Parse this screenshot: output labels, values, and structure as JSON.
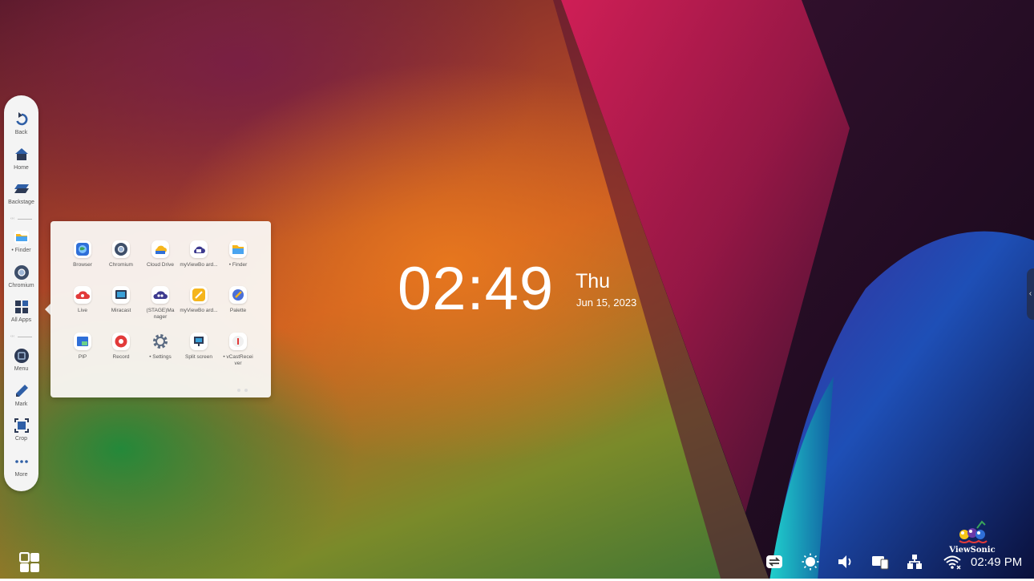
{
  "colors": {
    "toolbar_bg": "#f4f4f4",
    "accent_blue": "#2f5fa6",
    "icon_dark": "#2d3a55"
  },
  "toolbar": {
    "items": [
      {
        "label": "Back",
        "icon": "back-arrow-icon"
      },
      {
        "label": "Home",
        "icon": "home-icon"
      },
      {
        "label": "Backstage",
        "icon": "backstage-icon"
      },
      {
        "label": "• Finder",
        "icon": "folder-icon"
      },
      {
        "label": "Chromium",
        "icon": "chromium-icon"
      },
      {
        "label": "All Apps",
        "icon": "grid-icon"
      },
      {
        "label": "Menu",
        "icon": "menu-icon"
      },
      {
        "label": "Mark",
        "icon": "pen-icon"
      },
      {
        "label": "Crop",
        "icon": "crop-icon"
      },
      {
        "label": "More",
        "icon": "more-dots-icon"
      }
    ],
    "separator_text": "‹‹‹"
  },
  "apps_popup": {
    "apps": [
      {
        "label": "Browser",
        "icon": "browser-icon"
      },
      {
        "label": "Chromium",
        "icon": "chromium-icon"
      },
      {
        "label": "Cloud Drive",
        "icon": "cloud-drive-icon"
      },
      {
        "label": "myViewBo ard...",
        "icon": "myviewboard-icon"
      },
      {
        "label": "• Finder",
        "icon": "folder-icon"
      },
      {
        "label": "Live",
        "icon": "live-icon"
      },
      {
        "label": "Miracast",
        "icon": "miracast-icon"
      },
      {
        "label": "(STAGE)Ma nager",
        "icon": "stage-manager-icon"
      },
      {
        "label": "myViewBo ard...",
        "icon": "myviewboard-yellow-icon"
      },
      {
        "label": "Palette",
        "icon": "palette-icon"
      },
      {
        "label": "PIP",
        "icon": "pip-icon"
      },
      {
        "label": "Record",
        "icon": "record-icon"
      },
      {
        "label": "• Settings",
        "icon": "settings-gear-icon"
      },
      {
        "label": "Split screen",
        "icon": "split-screen-icon"
      },
      {
        "label": "• vCastRecei ver",
        "icon": "vcast-icon"
      }
    ]
  },
  "clock": {
    "time": "02:49",
    "day": "Thu",
    "date": "Jun 15, 2023"
  },
  "edge_handle": {
    "glyph": "‹"
  },
  "taskbar": {
    "logo_text": "ViewSonic",
    "time": "02:49 PM",
    "tray_icons": [
      "switch-icon",
      "brightness-icon",
      "volume-icon",
      "devices-icon",
      "network-icon",
      "wifi-icon"
    ]
  }
}
